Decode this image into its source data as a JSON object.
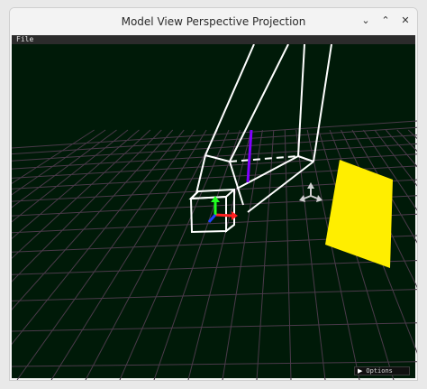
{
  "window": {
    "title": "Model View Perspective Projection",
    "controls": {
      "minimize": "⌄",
      "maximize": "⌃",
      "close": "✕"
    }
  },
  "menubar": {
    "items": [
      {
        "label": "File"
      }
    ]
  },
  "viewport": {
    "options_label": "Options",
    "options_icon": "triangle-right-icon",
    "colors": {
      "background": "#001a08",
      "grid": "#4a3a4a",
      "wireframe": "#ffffff",
      "plane": "#ffee00",
      "axis_x": "#ff2020",
      "axis_y": "#20ff20",
      "axis_z": "#2040ff",
      "vertical_line": "#8000ff",
      "gizmo": "#cfcfcf"
    }
  }
}
